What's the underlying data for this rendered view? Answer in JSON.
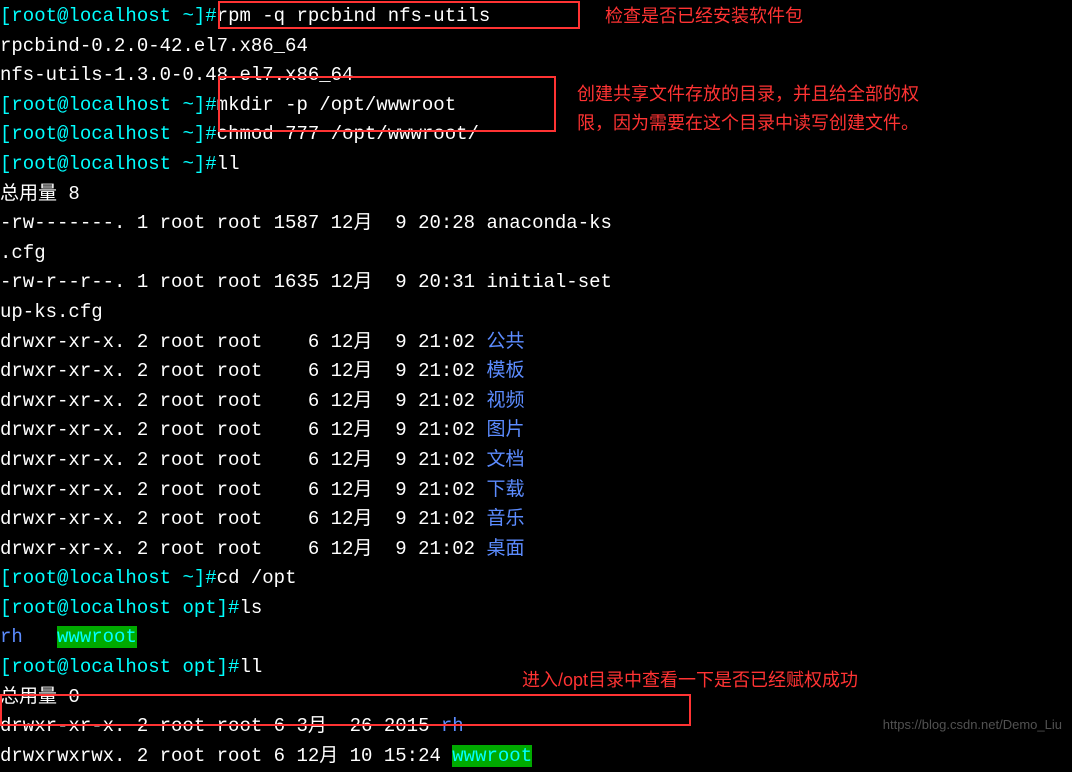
{
  "prompt_home": {
    "prefix": "[",
    "user_host": "root@localhost",
    "path": " ~",
    "suffix": "]#"
  },
  "prompt_opt": {
    "prefix": "[",
    "user_host": "root@localhost",
    "path": " opt",
    "suffix": "]#"
  },
  "cmd1": "rpm -q rpcbind nfs-utils",
  "out1a": "rpcbind-0.2.0-42.el7.x86_64",
  "out1b": "nfs-utils-1.3.0-0.48.el7.x86_64",
  "cmd2": "mkdir -p /opt/wwwroot",
  "cmd3": "chmod 777 /opt/wwwroot/",
  "cmd4": "ll",
  "total1": "总用量 8",
  "file1a": "-rw-------. 1 root root 1587 12月  9 20:28 anaconda-ks",
  "file1b": ".cfg",
  "file2a": "-rw-r--r--. 1 root root 1635 12月  9 20:31 initial-set",
  "file2b": "up-ks.cfg",
  "dir_prefix": "drwxr-xr-x. 2 root root    6 12月  9 21:02 ",
  "dirs": [
    "公共",
    "模板",
    "视频",
    "图片",
    "文档",
    "下载",
    "音乐",
    "桌面"
  ],
  "cmd5": "cd /opt",
  "cmd6": "ls",
  "ls_out": {
    "rh": "rh",
    "spacer": "   ",
    "wwwroot": "wwwroot"
  },
  "cmd7": "ll",
  "total2": "总用量 0",
  "opt_line1_pre": "drwxr-xr-x. 2 root root 6 3月  26 2015 ",
  "opt_line1_dir": "rh",
  "opt_line2_pre": "drwxrwxrwx. 2 root root 6 12月 10 15:24 ",
  "opt_line2_dir": "wwwroot",
  "annotation1": "检查是否已经安装软件包",
  "annotation2a": "创建共享文件存放的目录，并且给全部的权",
  "annotation2b": "限，因为需要在这个目录中读写创建文件。",
  "annotation3": "进入/opt目录中查看一下是否已经赋权成功",
  "watermark": "https://blog.csdn.net/Demo_Liu"
}
